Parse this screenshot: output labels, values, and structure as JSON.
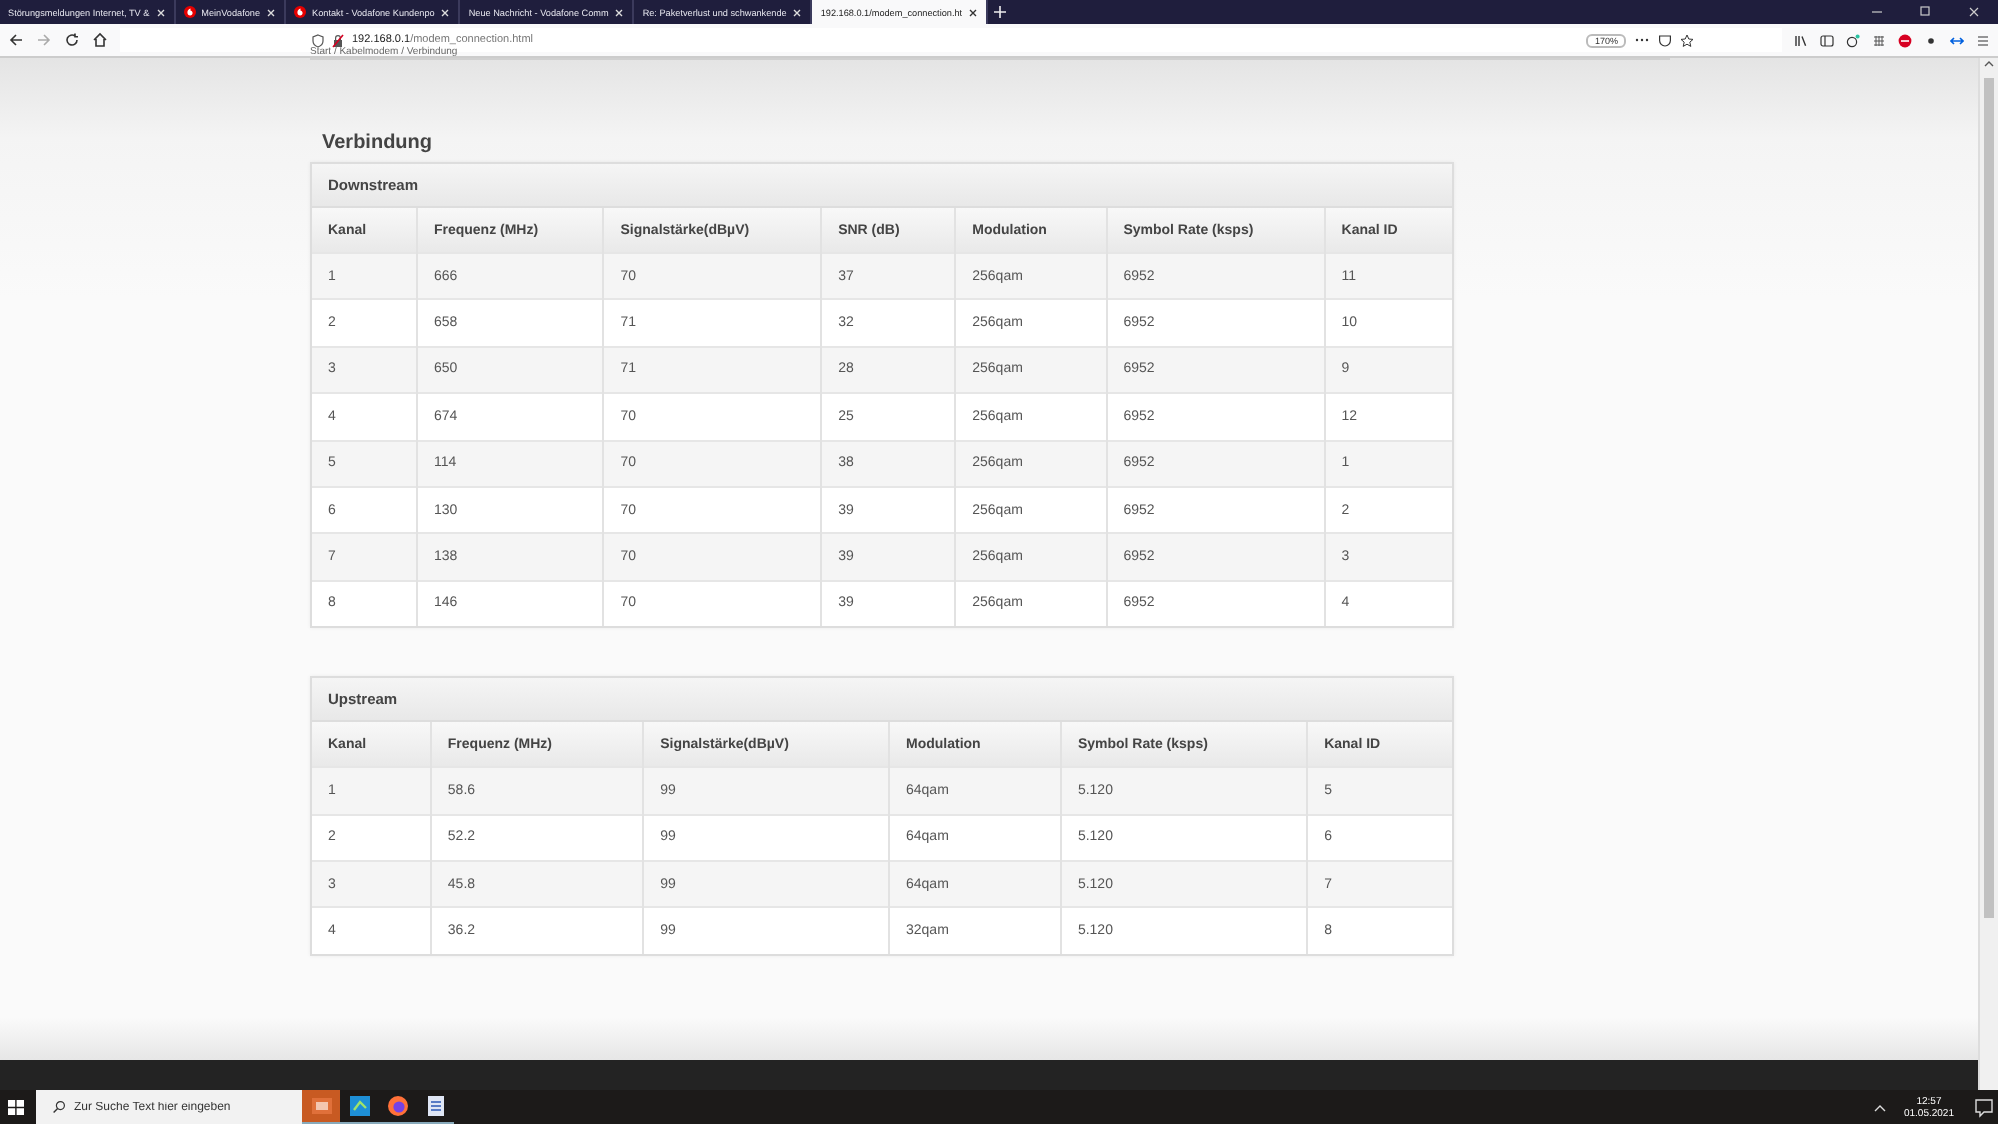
{
  "browser": {
    "tabs": [
      {
        "title": "Störungsmeldungen Internet, TV &",
        "selected": false,
        "favicon": false
      },
      {
        "title": "MeinVodafone",
        "selected": false,
        "favicon": true
      },
      {
        "title": "Kontakt - Vodafone Kundenpo",
        "selected": false,
        "favicon": true
      },
      {
        "title": "Neue Nachricht - Vodafone Comm",
        "selected": false,
        "favicon": false
      },
      {
        "title": "Re: Paketverlust und schwankende",
        "selected": false,
        "favicon": false
      },
      {
        "title": "192.168.0.1/modem_connection.ht",
        "selected": true,
        "favicon": false
      }
    ],
    "address": {
      "host": "192.168.0.1",
      "path": "/modem_connection.html"
    },
    "zoom": "170%"
  },
  "page": {
    "breadcrumb": "Start / Kabelmodem / Verbindung",
    "title": "Verbindung",
    "tables": [
      {
        "title": "Downstream",
        "columns": [
          "Kanal",
          "Frequenz (MHz)",
          "Signalstärke(dBµV)",
          "SNR (dB)",
          "Modulation",
          "Symbol Rate (ksps)",
          "Kanal ID"
        ],
        "rows": [
          [
            "1",
            "666",
            "70",
            "37",
            "256qam",
            "6952",
            "11"
          ],
          [
            "2",
            "658",
            "71",
            "32",
            "256qam",
            "6952",
            "10"
          ],
          [
            "3",
            "650",
            "71",
            "28",
            "256qam",
            "6952",
            "9"
          ],
          [
            "4",
            "674",
            "70",
            "25",
            "256qam",
            "6952",
            "12"
          ],
          [
            "5",
            "114",
            "70",
            "38",
            "256qam",
            "6952",
            "1"
          ],
          [
            "6",
            "130",
            "70",
            "39",
            "256qam",
            "6952",
            "2"
          ],
          [
            "7",
            "138",
            "70",
            "39",
            "256qam",
            "6952",
            "3"
          ],
          [
            "8",
            "146",
            "70",
            "39",
            "256qam",
            "6952",
            "4"
          ]
        ]
      },
      {
        "title": "Upstream",
        "columns": [
          "Kanal",
          "Frequenz (MHz)",
          "Signalstärke(dBµV)",
          "Modulation",
          "Symbol Rate (ksps)",
          "Kanal ID"
        ],
        "rows": [
          [
            "1",
            "58.6",
            "99",
            "64qam",
            "5.120",
            "5"
          ],
          [
            "2",
            "52.2",
            "99",
            "64qam",
            "5.120",
            "6"
          ],
          [
            "3",
            "45.8",
            "99",
            "64qam",
            "5.120",
            "7"
          ],
          [
            "4",
            "36.2",
            "99",
            "32qam",
            "5.120",
            "8"
          ]
        ]
      }
    ]
  },
  "taskbar": {
    "search": {
      "placeholder": "Zur Suche Text hier eingeben"
    },
    "time": "12:57",
    "date": "01.05.2021"
  }
}
